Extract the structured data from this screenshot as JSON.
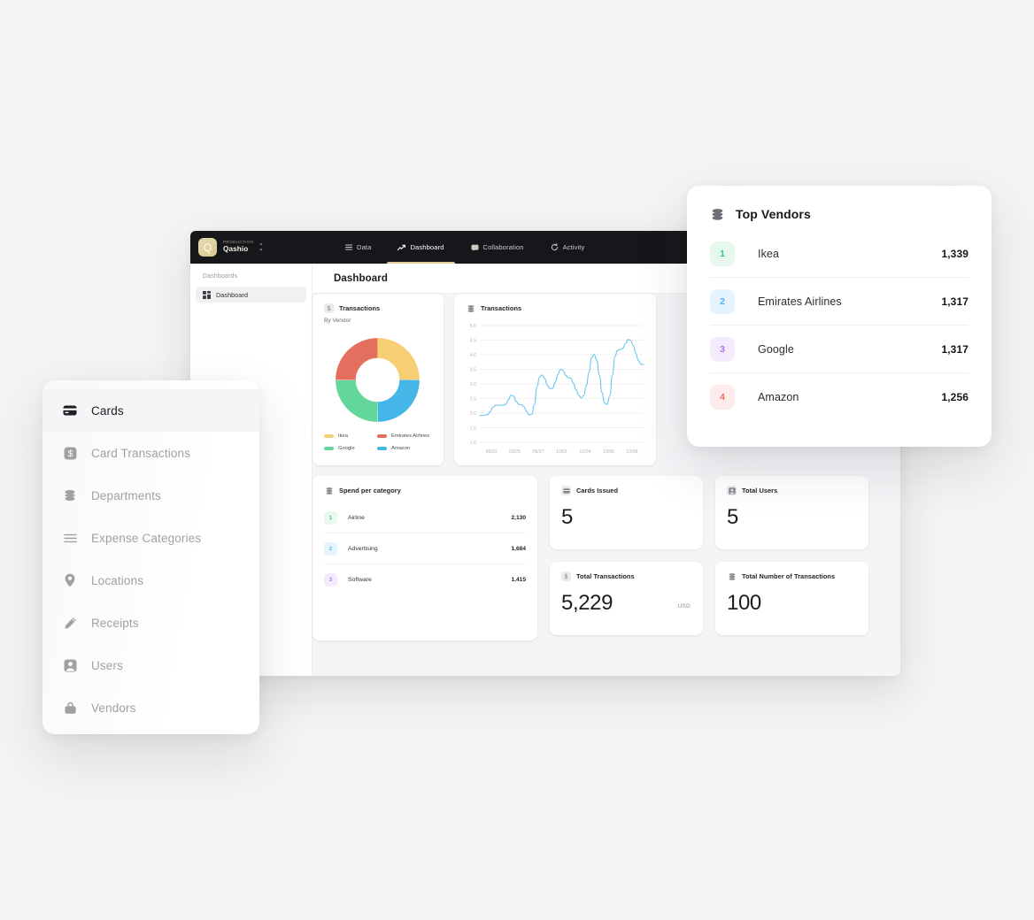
{
  "app": {
    "brand": {
      "env": "PRODUCTION",
      "name": "Qashio",
      "logo_letter": "Q",
      "logo_color": "#ddcb96"
    },
    "nav": [
      {
        "label": "Data",
        "icon": "list-icon",
        "active": false
      },
      {
        "label": "Dashboard",
        "icon": "trending-up-icon",
        "active": true
      },
      {
        "label": "Collaboration",
        "icon": "chat-icon",
        "active": false
      },
      {
        "label": "Activity",
        "icon": "refresh-icon",
        "active": false
      }
    ],
    "rail": {
      "title": "Dashboards",
      "item_label": "Dashboard",
      "item_icon": "grid-icon"
    },
    "page_title": "Dashboard"
  },
  "cards": {
    "donut": {
      "title": "Transactions",
      "subtitle": "By Vendor",
      "icon": "dollar-badge-icon"
    },
    "line": {
      "title": "Transactions",
      "icon": "database-icon"
    },
    "spend": {
      "title": "Spend per category",
      "icon": "database-icon",
      "rows": [
        {
          "rank": "1",
          "name": "Airline",
          "value": "2,130",
          "color": "#39c77f",
          "bg": "#e9f9f0"
        },
        {
          "rank": "2",
          "name": "Advertising",
          "value": "1,684",
          "color": "#4fb6ef",
          "bg": "#e6f4fd"
        },
        {
          "rank": "3",
          "name": "Software",
          "value": "1,415",
          "color": "#a974e8",
          "bg": "#f4ecfd"
        }
      ]
    },
    "stats": [
      {
        "key": "cards_issued",
        "label": "Cards Issued",
        "value": "5",
        "icon": "card-icon",
        "currency": ""
      },
      {
        "key": "total_users",
        "label": "Total Users",
        "value": "5",
        "icon": "user-icon",
        "currency": ""
      },
      {
        "key": "total_trans",
        "label": "Total Transactions",
        "value": "5,229",
        "icon": "dollar-badge-icon",
        "currency": "USD"
      },
      {
        "key": "total_number",
        "label": "Total Number of Transactions",
        "value": "100",
        "icon": "database-icon",
        "currency": ""
      }
    ]
  },
  "sidebar": {
    "items": [
      {
        "label": "Cards",
        "icon": "credit-card-icon",
        "active": true
      },
      {
        "label": "Card Transactions",
        "icon": "dollar-badge-icon",
        "active": false
      },
      {
        "label": "Departments",
        "icon": "database-icon",
        "active": false
      },
      {
        "label": "Expense Categories",
        "icon": "list-icon",
        "active": false
      },
      {
        "label": "Locations",
        "icon": "pin-icon",
        "active": false
      },
      {
        "label": "Receipts",
        "icon": "receipt-icon",
        "active": false
      },
      {
        "label": "Users",
        "icon": "user-icon",
        "active": false
      },
      {
        "label": "Vendors",
        "icon": "bag-icon",
        "active": false
      }
    ]
  },
  "vendors": {
    "title": "Top Vendors",
    "icon": "database-icon",
    "rows": [
      {
        "rank": "1",
        "name": "Ikea",
        "value": "1,339",
        "color": "#34c97c",
        "bg": "#e7f9ef"
      },
      {
        "rank": "2",
        "name": "Emirates Airlines",
        "value": "1,317",
        "color": "#4fb6ef",
        "bg": "#e4f3fd"
      },
      {
        "rank": "3",
        "name": "Google",
        "value": "1,317",
        "color": "#a974e8",
        "bg": "#f4ecfd"
      },
      {
        "rank": "4",
        "name": "Amazon",
        "value": "1,256",
        "color": "#ef6f62",
        "bg": "#fdeceb"
      }
    ]
  },
  "chart_data": [
    {
      "type": "pie",
      "title": "Transactions",
      "subtitle": "By Vendor",
      "labels": [
        "Ikea",
        "Emirates Airlines",
        "Google",
        "Amazon"
      ],
      "values": [
        25,
        25,
        25,
        25
      ],
      "colors": [
        "#f8ce74",
        "#e3705f",
        "#63d79b",
        "#45b6e8"
      ],
      "legend": "bottom",
      "donut": true
    },
    {
      "type": "line",
      "title": "Transactions",
      "xlabel": "",
      "ylabel": "",
      "ylim": [
        1.0,
        5.0
      ],
      "yticks": [
        "1.0",
        "1.5",
        "2.0",
        "2.5",
        "3.0",
        "3.5",
        "4.0",
        "4.5",
        "5.0"
      ],
      "xticks": [
        "09/22",
        "09/25",
        "09/27",
        "10/01",
        "10/04",
        "10/06",
        "10/08"
      ],
      "grid": true,
      "color": "#66c7ef",
      "series": [
        {
          "name": "Transactions",
          "values": [
            1.92,
            1.92,
            1.93,
            1.95,
            2.05,
            2.2,
            2.26,
            2.27,
            2.27,
            2.27,
            2.3,
            2.46,
            2.62,
            2.58,
            2.4,
            2.3,
            2.29,
            2.22,
            2.05,
            1.94,
            1.96,
            2.3,
            2.9,
            3.25,
            3.3,
            3.18,
            2.95,
            2.84,
            2.85,
            3.05,
            3.32,
            3.5,
            3.47,
            3.3,
            3.22,
            3.2,
            3.02,
            2.8,
            2.62,
            2.52,
            2.6,
            2.95,
            3.4,
            3.9,
            4.01,
            3.8,
            3.3,
            2.7,
            2.34,
            2.3,
            2.6,
            3.3,
            3.95,
            4.15,
            4.18,
            4.22,
            4.38,
            4.52,
            4.5,
            4.32,
            4.05,
            3.8,
            3.68,
            3.66
          ]
        }
      ]
    }
  ]
}
